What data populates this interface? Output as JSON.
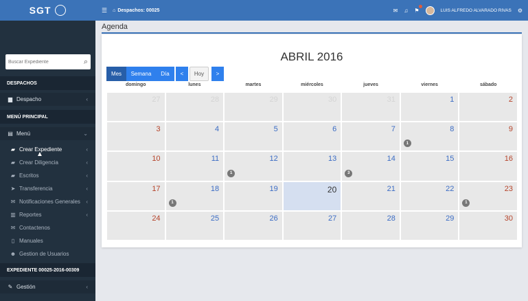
{
  "app": {
    "logo": "SGT"
  },
  "topbar": {
    "menu_icon": "☰",
    "context_label": "Despachos: 00025",
    "user_name": "LUIS ALFREDO ALVARADO RIVAS"
  },
  "sidebar": {
    "search_placeholder": "Buscar Expediente",
    "sections": [
      {
        "title": "DESPACHOS"
      },
      {
        "title": "MENÚ PRINCIPAL"
      },
      {
        "title": "EXPEDIENTE 00025-2016-00309"
      }
    ],
    "items": [
      {
        "label": "Despacho",
        "icon": "inbox-icon",
        "glyph": "▆",
        "chev": "‹"
      },
      {
        "label": "Menú",
        "icon": "menu-list-icon",
        "glyph": "▤",
        "chev": "⌄"
      },
      {
        "label": "Crear Expediente",
        "icon": "folder-open-icon",
        "glyph": "▰",
        "chev": "‹"
      },
      {
        "label": "Crear Diligencia",
        "icon": "folder-open-icon",
        "glyph": "▰",
        "chev": "‹"
      },
      {
        "label": "Escritos",
        "icon": "folder-open-icon",
        "glyph": "▰",
        "chev": "‹"
      },
      {
        "label": "Transferencia",
        "icon": "send-icon",
        "glyph": "➤",
        "chev": "‹"
      },
      {
        "label": "Notificaciones Generales",
        "icon": "envelope-icon",
        "glyph": "✉",
        "chev": "‹"
      },
      {
        "label": "Reportes",
        "icon": "chart-icon",
        "glyph": "▥",
        "chev": "‹"
      },
      {
        "label": "Contactenos",
        "icon": "envelope-icon",
        "glyph": "✉",
        "chev": ""
      },
      {
        "label": "Manuales",
        "icon": "file-icon",
        "glyph": "▯",
        "chev": ""
      },
      {
        "label": "Gestion de Usuarios",
        "icon": "users-icon",
        "glyph": "☻",
        "chev": ""
      },
      {
        "label": "Gestión",
        "icon": "edit-icon",
        "glyph": "✎",
        "chev": "‹"
      }
    ]
  },
  "page": {
    "title": "Agenda"
  },
  "calendar": {
    "title": "ABRIL 2016",
    "buttons": {
      "month": "Mes",
      "week": "Semana",
      "day": "Día",
      "prev": "<",
      "today": "Hoy",
      "next": ">"
    },
    "weekdays": [
      "domingo",
      "lunes",
      "martes",
      "miércoles",
      "jueves",
      "viernes",
      "sábado"
    ],
    "today": 20,
    "weeks": [
      [
        {
          "d": "27",
          "o": true
        },
        {
          "d": "28",
          "o": true
        },
        {
          "d": "29",
          "o": true
        },
        {
          "d": "30",
          "o": true
        },
        {
          "d": "31",
          "o": true
        },
        {
          "d": "1"
        },
        {
          "d": "2"
        }
      ],
      [
        {
          "d": "3"
        },
        {
          "d": "4"
        },
        {
          "d": "5"
        },
        {
          "d": "6"
        },
        {
          "d": "7"
        },
        {
          "d": "8",
          "b": "1"
        },
        {
          "d": "9"
        }
      ],
      [
        {
          "d": "10"
        },
        {
          "d": "11"
        },
        {
          "d": "12",
          "b": "1"
        },
        {
          "d": "13"
        },
        {
          "d": "14",
          "b": "3"
        },
        {
          "d": "15"
        },
        {
          "d": "16"
        }
      ],
      [
        {
          "d": "17"
        },
        {
          "d": "18",
          "b": "1"
        },
        {
          "d": "19"
        },
        {
          "d": "20"
        },
        {
          "d": "21"
        },
        {
          "d": "22"
        },
        {
          "d": "23",
          "b": "1"
        }
      ],
      [
        {
          "d": "24"
        },
        {
          "d": "25"
        },
        {
          "d": "26"
        },
        {
          "d": "27"
        },
        {
          "d": "28"
        },
        {
          "d": "29"
        },
        {
          "d": "30"
        }
      ]
    ]
  }
}
